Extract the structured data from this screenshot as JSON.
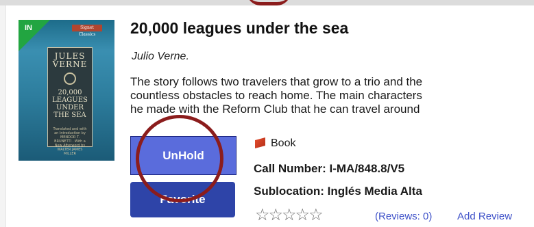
{
  "item": {
    "availability_badge": "IN",
    "title": "20,000 leagues under the sea",
    "author": "Julio Verne.",
    "summary": "The story follows two travelers that grow to a trio and the\ncountless obstacles to reach home. The main characters\nhe made with the Reform Club that he can travel around",
    "format_label": "Book",
    "call_number": "Call Number: I-MA/848.8/V5",
    "sublocation": "Sublocation: Inglés Media Alta",
    "reviews": "(Reviews: 0)",
    "add_review": "Add Review"
  },
  "cover": {
    "publisher": "Signet Classics",
    "author_art": "JULES\nVERNE",
    "title_art": "20,000\nLEAGUES\nUNDER\nTHE SEA",
    "credits": "Translated and with an Introduction by MENDOR T. BRUNETTI · With a New Afterword by WALTER JAMES MILLER"
  },
  "actions": {
    "unhold_label": "UnHold",
    "favorite_label": "Favorite"
  },
  "rating": {
    "stars": "☆☆☆☆☆",
    "value": 0,
    "max": 5
  },
  "colors": {
    "primary_button": "#2e44a8",
    "hold_button": "#5a6cdc",
    "badge_green": "#22a541",
    "link": "#3d50c8",
    "highlight_circle": "#8b1c1c"
  }
}
